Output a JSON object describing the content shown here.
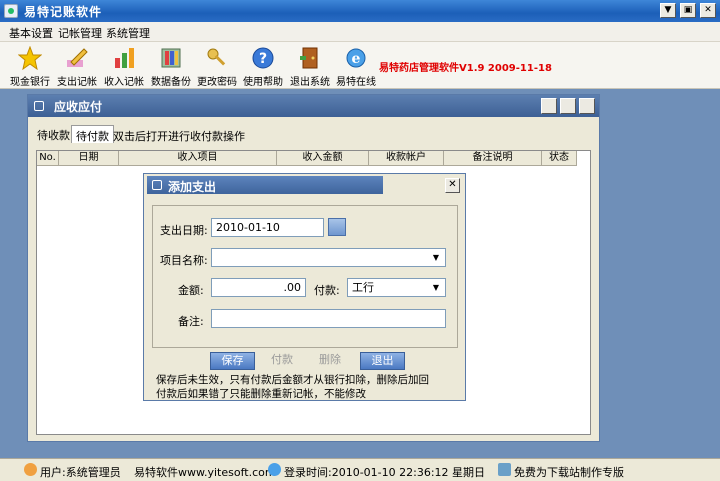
{
  "window": {
    "title": "易特记账软件"
  },
  "menu": [
    "基本设置",
    "记帐管理",
    "系统管理"
  ],
  "toolbar": [
    {
      "label": "现金银行",
      "icon": "star-icon"
    },
    {
      "label": "支出记帐",
      "icon": "pencil-icon"
    },
    {
      "label": "收入记帐",
      "icon": "bar-chart-icon"
    },
    {
      "label": "数据备份",
      "icon": "backup-icon"
    },
    {
      "label": "更改密码",
      "icon": "key-icon"
    },
    {
      "label": "使用帮助",
      "icon": "help-icon"
    },
    {
      "label": "退出系统",
      "icon": "exit-door-icon"
    },
    {
      "label": "易特在线",
      "icon": "internet-icon"
    }
  ],
  "version_text": "易特药店管理软件V1.9 2009-11-18",
  "child": {
    "title": "应收应付",
    "tabs": [
      "待收款",
      "待付款"
    ],
    "active_tab": 1,
    "hint": "双击后打开进行收付款操作",
    "columns": [
      "No.",
      "日期",
      "收入项目",
      "收入金额",
      "收款帐户",
      "备注说明",
      "状态"
    ]
  },
  "dialog": {
    "title": "添加支出",
    "date_label": "支出日期:",
    "date_value": "2010-01-10",
    "project_label": "项目名称:",
    "project_value": "",
    "amount_label": "金额:",
    "amount_value": ".00",
    "payment_label": "付款:",
    "payment_value": "工行",
    "remark_label": "备注:",
    "remark_value": "",
    "save": "保存",
    "pay": "付款",
    "delete": "删除",
    "exit": "退出",
    "note1": "保存后未生效，只有付款后金额才从银行扣除，删除后加回",
    "note2": "付款后如果错了只能删除重新记帐，不能修改"
  },
  "status": {
    "user": "用户:系统管理员",
    "website": "易特软件www.yitesoft.com",
    "login_time": "登录时间:2010-01-10 22:36:12 星期日",
    "edition": "免费为下载站制作专版"
  },
  "colors": {
    "accent_title": "#1c5fb8",
    "version_red": "#e00000"
  }
}
